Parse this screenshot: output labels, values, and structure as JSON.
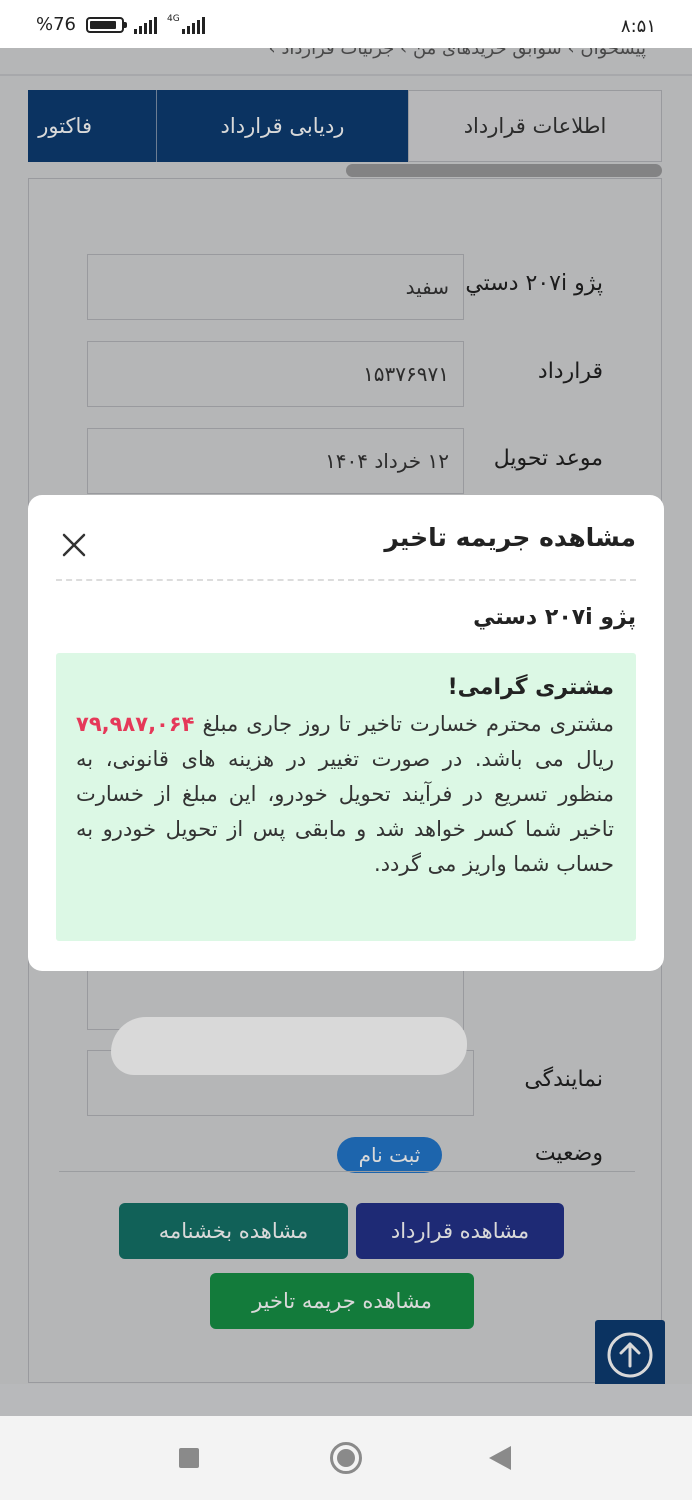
{
  "status_bar": {
    "time": "۸:۵۱",
    "battery": "%76",
    "network": "4G"
  },
  "breadcrumb": "پیشخوان › سوابق خریدهای من › جزئیات قرارداد ›",
  "tabs": [
    {
      "label": "اطلاعات قرارداد",
      "active": false
    },
    {
      "label": "ردیابی قرارداد",
      "active": true
    },
    {
      "label": "فاکتور",
      "active": true
    }
  ],
  "fields": {
    "car": {
      "label": "پژو ۲۰۷i دستي",
      "value": "سفيد"
    },
    "contract": {
      "label": "قرارداد",
      "value": "۱۵۳۷۶۹۷۱"
    },
    "delivery": {
      "label": "موعد تحویل",
      "value": "۱۲ خرداد ۱۴۰۴"
    },
    "agency": {
      "label": "نمایندگی",
      "value": ""
    },
    "status": {
      "label": "وضعیت",
      "value": "ثبت نام"
    }
  },
  "buttons": {
    "view_contract": "مشاهده قرارداد",
    "view_circular": "مشاهده بخشنامه",
    "view_penalty": "مشاهده جریمه تاخیر"
  },
  "modal": {
    "title": "مشاهده جریمه تاخیر",
    "car_name": "پژو ۲۰۷i دستي",
    "greeting": "مشتری گرامی!",
    "message_before": "مشتری محترم خسارت تاخیر تا روز جاری مبلغ",
    "amount": "۷۹,۹۸۷,۰۶۴",
    "message_after": "ریال می باشد. در صورت تغییر در هزینه های قانونی، به منظور تسریع در فرآیند تحویل خودرو، این مبلغ از خسارت تاخیر شما کسر خواهد شد و مابقی پس از تحویل خودرو به حساب شما واریز می گردد."
  },
  "colors": {
    "primary": "#0d3d73",
    "amount": "#e53959",
    "notice_bg": "#dcf8e5",
    "status_pill": "#2377cc"
  }
}
